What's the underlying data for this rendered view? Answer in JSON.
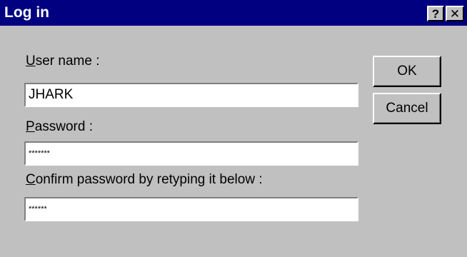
{
  "window": {
    "title": "Log in",
    "help_glyph": "?",
    "close_glyph": "✕"
  },
  "form": {
    "username": {
      "label_mnemonic": "U",
      "label_rest": "ser name :",
      "value": "JHARK"
    },
    "password": {
      "label_mnemonic": "P",
      "label_rest": "assword :",
      "value": "*******"
    },
    "confirm": {
      "label_mnemonic": "C",
      "label_rest": "onfirm password by retyping it below :",
      "value": "******"
    }
  },
  "buttons": {
    "ok_label": "OK",
    "cancel_label": "Cancel"
  },
  "colors": {
    "titlebar": "#000080",
    "face": "#c0c0c0"
  }
}
